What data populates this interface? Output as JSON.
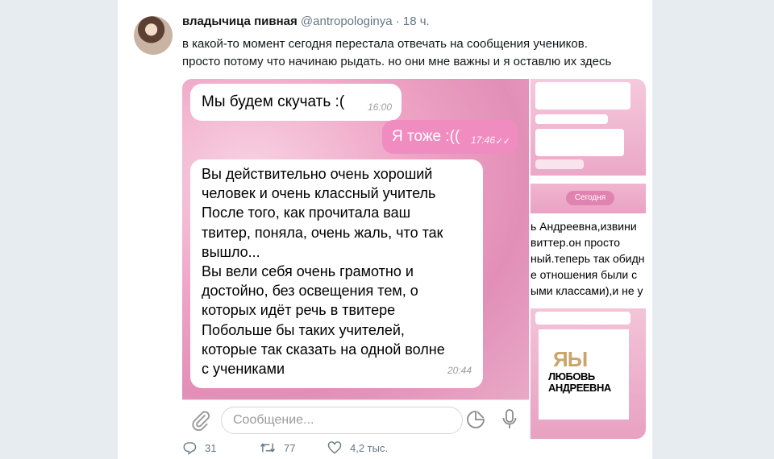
{
  "tweet": {
    "display_name": "владычица пивная",
    "handle": "@antropologinya",
    "separator": "·",
    "time": "18 ч.",
    "text_line1": "в какой-то момент сегодня перестала отвечать на сообщения учеников.",
    "text_line2": "просто потому что начинаю рыдать. но они мне важны и я оставлю их здесь"
  },
  "chat": {
    "msg1": {
      "text": "Мы будем скучать :(",
      "time": "16:00"
    },
    "msg2": {
      "text": "Я тоже :((",
      "time": "17:46"
    },
    "msg3": {
      "lines": [
        "Вы  действительно очень хороший",
        "человек и очень классный  учитель",
        "После того, как прочитала ваш",
        "твитер, поняла, очень жаль, что так",
        "вышло...",
        "Вы вели себя очень грамотно и",
        "достойно, без освещения тем, о",
        "которых идёт речь в твитере",
        "Побольше бы таких учителей,",
        "которые так сказать на одной волне",
        "с учениками"
      ],
      "time": "20:44"
    },
    "input_placeholder": "Сообщение..."
  },
  "right_column": {
    "today_label": "Сегодня",
    "strip_lines": [
      "ь Андреевна,извини",
      "виттер.он просто",
      "ный.теперь так обидн",
      "е отношения были с",
      "ыми классами),и не у к"
    ],
    "logo_top": "ЯЫ",
    "logo_line1": "ЛЮБОВЬ",
    "logo_line2": "АНДРЕЕВНА"
  },
  "actions": {
    "replies": "31",
    "retweets": "77",
    "likes": "4,2 тыс."
  },
  "colors": {
    "outgoing_bubble": "#f18cc1",
    "chat_background": "#efa5c6",
    "twitter_gray": "#657786"
  }
}
